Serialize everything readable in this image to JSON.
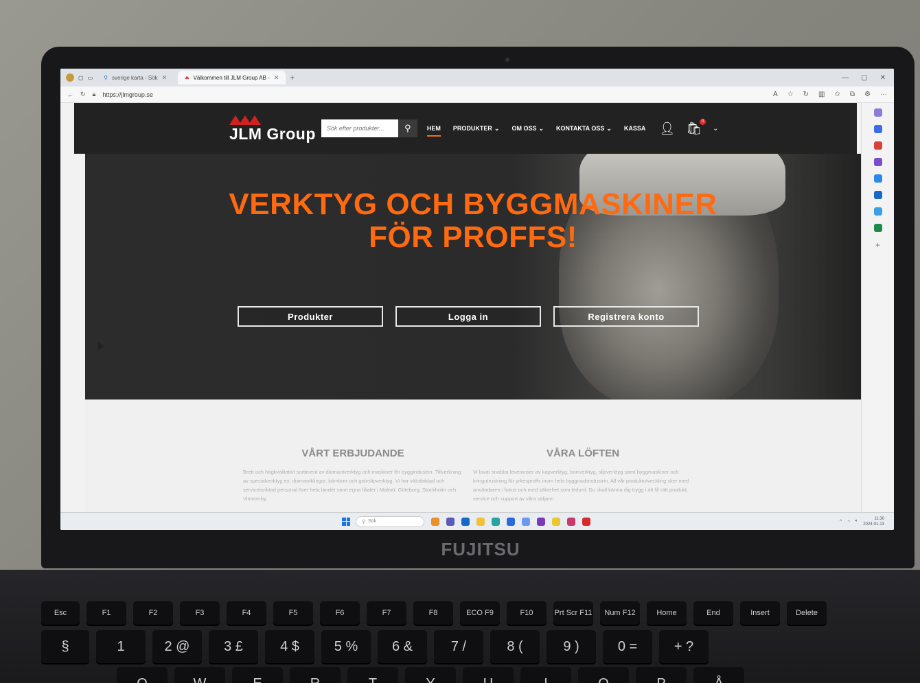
{
  "browser": {
    "tabs": [
      {
        "label": "sverige karta - Sök",
        "active": false
      },
      {
        "label": "Välkommen till JLM Group AB -",
        "active": true
      }
    ],
    "new_tab": "+",
    "url": "https://jlmgroup.se"
  },
  "site": {
    "logo_text": "JLM Group",
    "search_placeholder": "Sök efter produkter...",
    "nav": [
      {
        "label": "HEM",
        "active": true,
        "dropdown": false
      },
      {
        "label": "PRODUKTER",
        "active": false,
        "dropdown": true
      },
      {
        "label": "OM OSS",
        "active": false,
        "dropdown": true
      },
      {
        "label": "KONTAKTA OSS",
        "active": false,
        "dropdown": true
      },
      {
        "label": "KASSA",
        "active": false,
        "dropdown": false
      }
    ],
    "cart_count": "0",
    "hero": {
      "title_line1": "VERKTYG OCH BYGGMASKINER",
      "title_line2": "FÖR PROFFS!",
      "buttons": [
        "Produkter",
        "Logga in",
        "Registrera konto"
      ]
    },
    "offer": {
      "heading": "VÅRT ERBJUDANDE",
      "text": "Brett och högkvalitativt sortiment av diamantverktyg och maskiner för byggindustrin. Tillverkning av specialverktyg ex. diamantklingor, kärnborr och golvslipverktyg. Vi har välutbildad och serviceinriktad personal över hela landet samt egna filialer i Malmö, Göteborg, Stockholm och Vimmerby."
    },
    "promises": {
      "heading": "VÅRA LÖFTEN",
      "text": "Vi lovar snabba leveranser av kapverktyg, borrverktyg, slipverktyg samt byggmaskiner och kringutrustning för yrkesproffs inom hela byggnadsindustrin. All vår produktutveckling sker med användaren i fokus och med säkerhet som ledord. Du skall känna dig trygg i att få rätt produkt, service och support av våra säljare."
    }
  },
  "taskbar": {
    "search_label": "Sök",
    "clock_time": "11:30",
    "clock_date": "2024-01-13"
  },
  "laptop": {
    "brand": "FUJITSU",
    "fkeys": [
      "Esc",
      "F1",
      "F2",
      "F3",
      "F4",
      "F5",
      "F6",
      "F7",
      "F8",
      "ECO F9",
      "F10",
      "Prt Scr F11",
      "Num F12",
      "Home",
      "End",
      "Insert",
      "Delete"
    ],
    "numrow": [
      "§",
      "1",
      "2 @",
      "3 £",
      "4 $",
      "5 %",
      "6 &",
      "7 /",
      "8 (",
      "9 )",
      "0 =",
      "+ ?"
    ],
    "letters": [
      "Q",
      "W",
      "E",
      "R",
      "T",
      "Y",
      "U",
      "I",
      "O",
      "P",
      "Å"
    ]
  },
  "colors": {
    "accent": "#ff6a10",
    "header_bg": "#222222",
    "logo_red": "#d32020"
  }
}
